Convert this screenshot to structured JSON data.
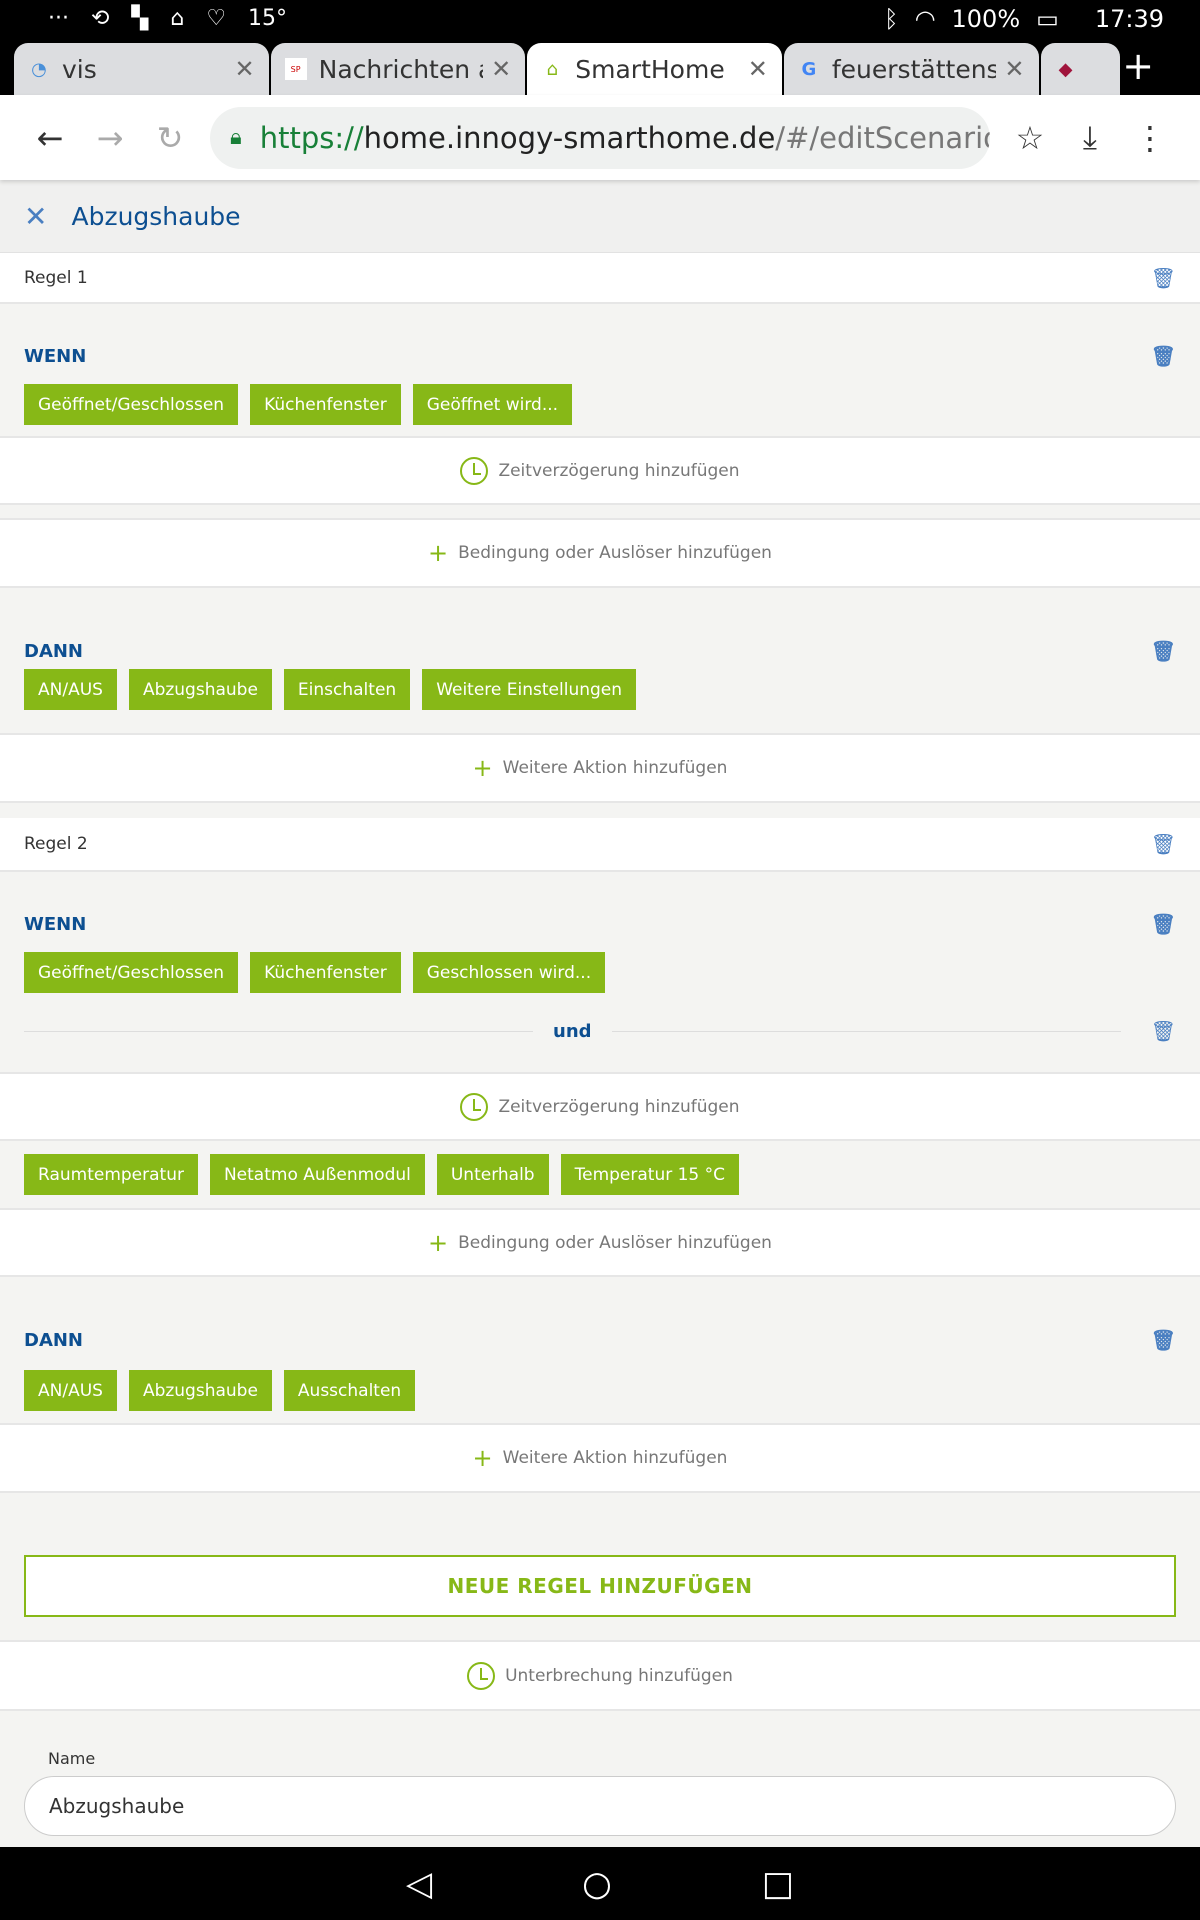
{
  "status": {
    "temp": "15°",
    "battery": "100%",
    "time": "17:39"
  },
  "tabs": [
    {
      "title": "vis"
    },
    {
      "title": "Nachrichten a"
    },
    {
      "title": "SmartHome"
    },
    {
      "title": "feuerstättens"
    }
  ],
  "url": {
    "scheme": "https://",
    "host": "home.innogy-smarthome.de",
    "path": "/#/editScenario?_I"
  },
  "header": {
    "title": "Abzugshaube"
  },
  "rules": [
    {
      "title": "Regel 1",
      "when_label": "WENN",
      "when_chips": [
        "Geöffnet/Geschlossen",
        "Küchenfenster",
        "Geöffnet wird..."
      ],
      "delay": "Zeitverzögerung hinzufügen",
      "add_condition": "Bedingung oder Auslöser hinzufügen",
      "then_label": "DANN",
      "then_chips": [
        "AN/AUS",
        "Abzugshaube",
        "Einschalten",
        "Weitere Einstellungen"
      ],
      "add_action": "Weitere Aktion hinzufügen"
    },
    {
      "title": "Regel 2",
      "when_label": "WENN",
      "when_chips": [
        "Geöffnet/Geschlossen",
        "Küchenfenster",
        "Geschlossen wird..."
      ],
      "and_label": "und",
      "delay": "Zeitverzögerung hinzufügen",
      "cond2_chips": [
        "Raumtemperatur",
        "Netatmo Außenmodul",
        "Unterhalb",
        "Temperatur 15 °C"
      ],
      "add_condition": "Bedingung oder Auslöser hinzufügen",
      "then_label": "DANN",
      "then_chips": [
        "AN/AUS",
        "Abzugshaube",
        "Ausschalten"
      ],
      "add_action": "Weitere Aktion hinzufügen"
    }
  ],
  "new_rule": "NEUE REGEL HINZUFÜGEN",
  "interruption": "Unterbrechung hinzufügen",
  "name": {
    "label": "Name",
    "value": "Abzugshaube"
  }
}
